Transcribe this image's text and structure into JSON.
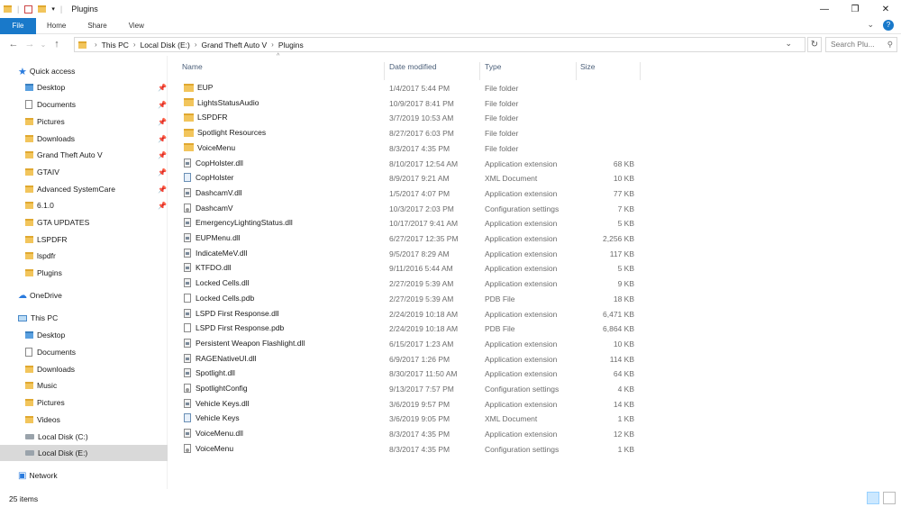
{
  "window": {
    "title": "Plugins",
    "controls": [
      "—",
      "❐",
      "✕"
    ]
  },
  "ribbon": {
    "tabs": [
      "File",
      "Home",
      "Share",
      "View"
    ]
  },
  "address": {
    "crumbs": [
      "This PC",
      "Local Disk (E:)",
      "Grand Theft Auto V",
      "Plugins"
    ],
    "search_placeholder": "Search Plu..."
  },
  "nav": {
    "quick_access": "Quick access",
    "quick_items": [
      {
        "label": "Desktop",
        "pinned": true
      },
      {
        "label": "Documents",
        "pinned": true
      },
      {
        "label": "Pictures",
        "pinned": true
      },
      {
        "label": "Downloads",
        "pinned": true
      },
      {
        "label": "Grand Theft Auto V",
        "pinned": true
      },
      {
        "label": "GTAIV",
        "pinned": true
      },
      {
        "label": "Advanced SystemCare",
        "pinned": true
      },
      {
        "label": "6.1.0",
        "pinned": true
      },
      {
        "label": "GTA UPDATES",
        "pinned": false
      },
      {
        "label": "LSPDFR",
        "pinned": false
      },
      {
        "label": "lspdfr",
        "pinned": false
      },
      {
        "label": "Plugins",
        "pinned": false
      }
    ],
    "onedrive": "OneDrive",
    "this_pc": "This PC",
    "pc_items": [
      "Desktop",
      "Documents",
      "Downloads",
      "Music",
      "Pictures",
      "Videos"
    ],
    "drives": [
      "Local Disk (C:)",
      "Local Disk (E:)"
    ],
    "network": "Network"
  },
  "columns": {
    "name": "Name",
    "date": "Date modified",
    "type": "Type",
    "size": "Size"
  },
  "files": [
    {
      "name": "EUP",
      "date": "1/4/2017 5:44 PM",
      "type": "File folder",
      "size": "",
      "icon": "folder"
    },
    {
      "name": "LightsStatusAudio",
      "date": "10/9/2017 8:41 PM",
      "type": "File folder",
      "size": "",
      "icon": "folder"
    },
    {
      "name": "LSPDFR",
      "date": "3/7/2019 10:53 AM",
      "type": "File folder",
      "size": "",
      "icon": "folder"
    },
    {
      "name": "Spotlight Resources",
      "date": "8/27/2017 6:03 PM",
      "type": "File folder",
      "size": "",
      "icon": "folder"
    },
    {
      "name": "VoiceMenu",
      "date": "8/3/2017 4:35 PM",
      "type": "File folder",
      "size": "",
      "icon": "folder"
    },
    {
      "name": "CopHolster.dll",
      "date": "8/10/2017 12:54 AM",
      "type": "Application extension",
      "size": "68 KB",
      "icon": "dll"
    },
    {
      "name": "CopHolster",
      "date": "8/9/2017 9:21 AM",
      "type": "XML Document",
      "size": "10 KB",
      "icon": "xml"
    },
    {
      "name": "DashcamV.dll",
      "date": "1/5/2017 4:07 PM",
      "type": "Application extension",
      "size": "77 KB",
      "icon": "dll"
    },
    {
      "name": "DashcamV",
      "date": "10/3/2017 2:03 PM",
      "type": "Configuration settings",
      "size": "7 KB",
      "icon": "cfg"
    },
    {
      "name": "EmergencyLightingStatus.dll",
      "date": "10/17/2017 9:41 AM",
      "type": "Application extension",
      "size": "5 KB",
      "icon": "dll"
    },
    {
      "name": "EUPMenu.dll",
      "date": "6/27/2017 12:35 PM",
      "type": "Application extension",
      "size": "2,256 KB",
      "icon": "dll"
    },
    {
      "name": "IndicateMeV.dll",
      "date": "9/5/2017 8:29 AM",
      "type": "Application extension",
      "size": "117 KB",
      "icon": "dll"
    },
    {
      "name": "KTFDO.dll",
      "date": "9/11/2016 5:44 AM",
      "type": "Application extension",
      "size": "5 KB",
      "icon": "dll"
    },
    {
      "name": "Locked Cells.dll",
      "date": "2/27/2019 5:39 AM",
      "type": "Application extension",
      "size": "9 KB",
      "icon": "dll"
    },
    {
      "name": "Locked Cells.pdb",
      "date": "2/27/2019 5:39 AM",
      "type": "PDB File",
      "size": "18 KB",
      "icon": "file"
    },
    {
      "name": "LSPD First Response.dll",
      "date": "2/24/2019 10:18 AM",
      "type": "Application extension",
      "size": "6,471 KB",
      "icon": "dll"
    },
    {
      "name": "LSPD First Response.pdb",
      "date": "2/24/2019 10:18 AM",
      "type": "PDB File",
      "size": "6,864 KB",
      "icon": "file"
    },
    {
      "name": "Persistent Weapon Flashlight.dll",
      "date": "6/15/2017 1:23 AM",
      "type": "Application extension",
      "size": "10 KB",
      "icon": "dll"
    },
    {
      "name": "RAGENativeUI.dll",
      "date": "6/9/2017 1:26 PM",
      "type": "Application extension",
      "size": "114 KB",
      "icon": "dll"
    },
    {
      "name": "Spotlight.dll",
      "date": "8/30/2017 11:50 AM",
      "type": "Application extension",
      "size": "64 KB",
      "icon": "dll"
    },
    {
      "name": "SpotlightConfig",
      "date": "9/13/2017 7:57 PM",
      "type": "Configuration settings",
      "size": "4 KB",
      "icon": "cfg"
    },
    {
      "name": "Vehicle Keys.dll",
      "date": "3/6/2019 9:57 PM",
      "type": "Application extension",
      "size": "14 KB",
      "icon": "dll"
    },
    {
      "name": "Vehicle Keys",
      "date": "3/6/2019 9:05 PM",
      "type": "XML Document",
      "size": "1 KB",
      "icon": "xml"
    },
    {
      "name": "VoiceMenu.dll",
      "date": "8/3/2017 4:35 PM",
      "type": "Application extension",
      "size": "12 KB",
      "icon": "dll"
    },
    {
      "name": "VoiceMenu",
      "date": "8/3/2017 4:35 PM",
      "type": "Configuration settings",
      "size": "1 KB",
      "icon": "cfg"
    }
  ],
  "status": {
    "count": "25 items"
  }
}
